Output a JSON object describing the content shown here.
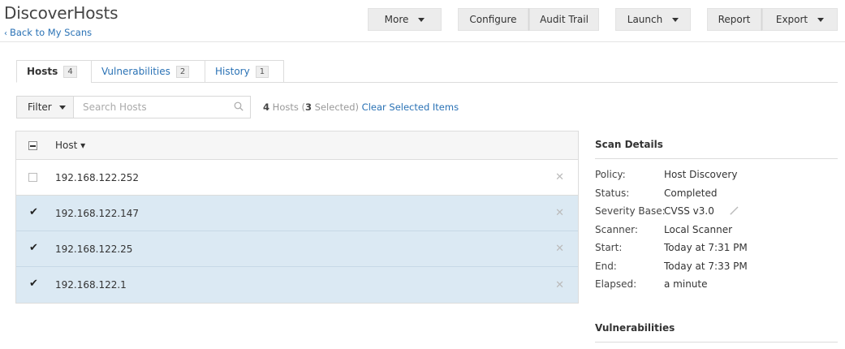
{
  "header": {
    "title": "DiscoverHosts",
    "back_link": "Back to My Scans",
    "buttons": {
      "more": "More",
      "configure": "Configure",
      "audit_trail": "Audit Trail",
      "launch": "Launch",
      "report": "Report",
      "export": "Export"
    }
  },
  "tabs": [
    {
      "label": "Hosts",
      "count": "4"
    },
    {
      "label": "Vulnerabilities",
      "count": "2"
    },
    {
      "label": "History",
      "count": "1"
    }
  ],
  "toolbar": {
    "filter_label": "Filter",
    "search_placeholder": "Search Hosts",
    "summary_count": "4",
    "summary_hosts_word": " Hosts (",
    "summary_selected_count": "3",
    "summary_selected_word": " Selected) ",
    "clear_label": "Clear Selected Items"
  },
  "table": {
    "column_host": "Host ▾",
    "rows": [
      {
        "host": "192.168.122.252",
        "selected": false
      },
      {
        "host": "192.168.122.147",
        "selected": true
      },
      {
        "host": "192.168.122.25",
        "selected": true
      },
      {
        "host": "192.168.122.1",
        "selected": true
      }
    ]
  },
  "scan_details": {
    "title": "Scan Details",
    "policy_label": "Policy:",
    "policy_value": "Host Discovery",
    "status_label": "Status:",
    "status_value": "Completed",
    "severity_label": "Severity Base:",
    "severity_value": "CVSS v3.0",
    "scanner_label": "Scanner:",
    "scanner_value": "Local Scanner",
    "start_label": "Start:",
    "start_value": "Today at 7:31 PM",
    "end_label": "End:",
    "end_value": "Today at 7:33 PM",
    "elapsed_label": "Elapsed:",
    "elapsed_value": "a minute"
  },
  "vulnerabilities_panel": {
    "title": "Vulnerabilities"
  },
  "colors": {
    "link": "#2a72b5",
    "selected_row": "#dbe9f3",
    "button_bg": "#ececec"
  }
}
